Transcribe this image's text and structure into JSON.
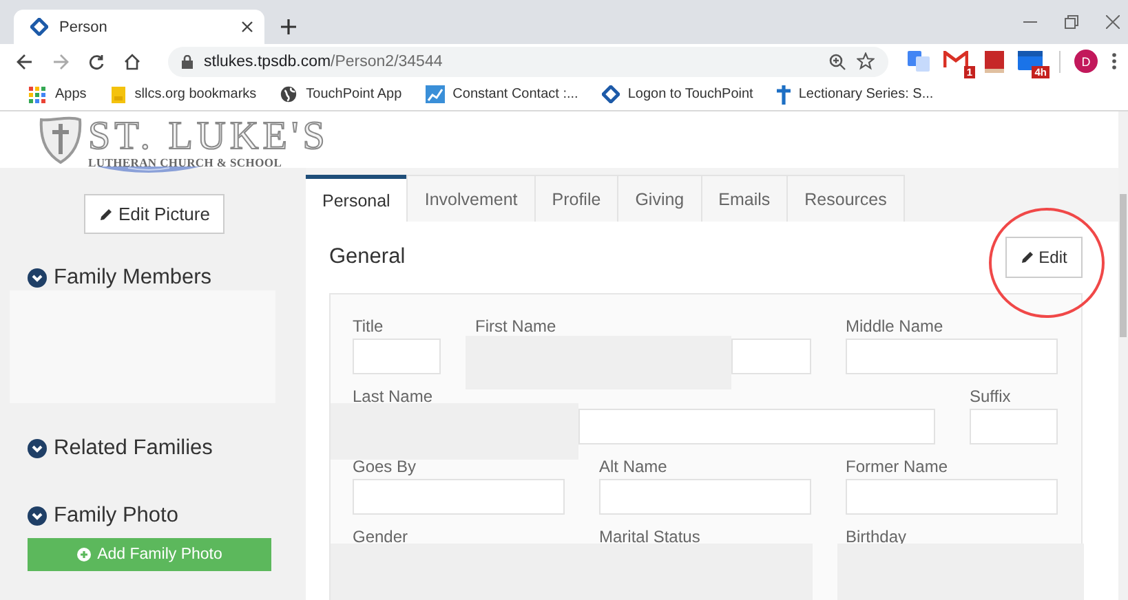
{
  "browser": {
    "tabs": [
      {
        "title": "Person",
        "selected": true
      }
    ],
    "url_host": "stlukes.tpsdb.com",
    "url_path": "/Person2/34544",
    "bookmarks": [
      {
        "label": "Apps",
        "kind": "apps"
      },
      {
        "label": "sllcs.org bookmarks",
        "kind": "folder"
      },
      {
        "label": "TouchPoint App",
        "kind": "globe"
      },
      {
        "label": "Constant Contact :...",
        "kind": "chart"
      },
      {
        "label": "Logon to TouchPoint",
        "kind": "touchpoint"
      },
      {
        "label": "Lectionary Series: S...",
        "kind": "cross"
      }
    ],
    "extensions": [
      {
        "kind": "translate"
      },
      {
        "kind": "mail",
        "badge": "1"
      },
      {
        "kind": "book"
      },
      {
        "kind": "calendar",
        "badge": "4h"
      }
    ],
    "profile": "D"
  },
  "logo": {
    "name": "ST. LUKE'S",
    "subtitle": "LUTHERAN CHURCH & SCHOOL"
  },
  "sidebar": {
    "edit_picture": "Edit Picture",
    "sections": [
      {
        "title": "Family Members",
        "expanded": true
      },
      {
        "title": "Related Families",
        "expanded": true
      },
      {
        "title": "Family Photo",
        "expanded": true
      }
    ],
    "add_family_photo": "Add Family Photo"
  },
  "tabs": [
    {
      "label": "Personal",
      "selected": true
    },
    {
      "label": "Involvement",
      "selected": false
    },
    {
      "label": "Profile",
      "selected": false
    },
    {
      "label": "Giving",
      "selected": false
    },
    {
      "label": "Emails",
      "selected": false
    },
    {
      "label": "Resources",
      "selected": false
    }
  ],
  "general": {
    "title": "General",
    "edit": "Edit",
    "rows": [
      [
        {
          "label": "Title"
        },
        {
          "label": "First Name"
        },
        {
          "label": "Middle Name"
        }
      ],
      [
        {
          "label": "Last Name"
        },
        {
          "label": "Suffix"
        }
      ],
      [
        {
          "label": "Goes By"
        },
        {
          "label": "Alt Name"
        },
        {
          "label": "Former Name"
        }
      ],
      [
        {
          "label": "Gender"
        },
        {
          "label": "Marital Status"
        },
        {
          "label": "Birthday"
        }
      ]
    ]
  }
}
